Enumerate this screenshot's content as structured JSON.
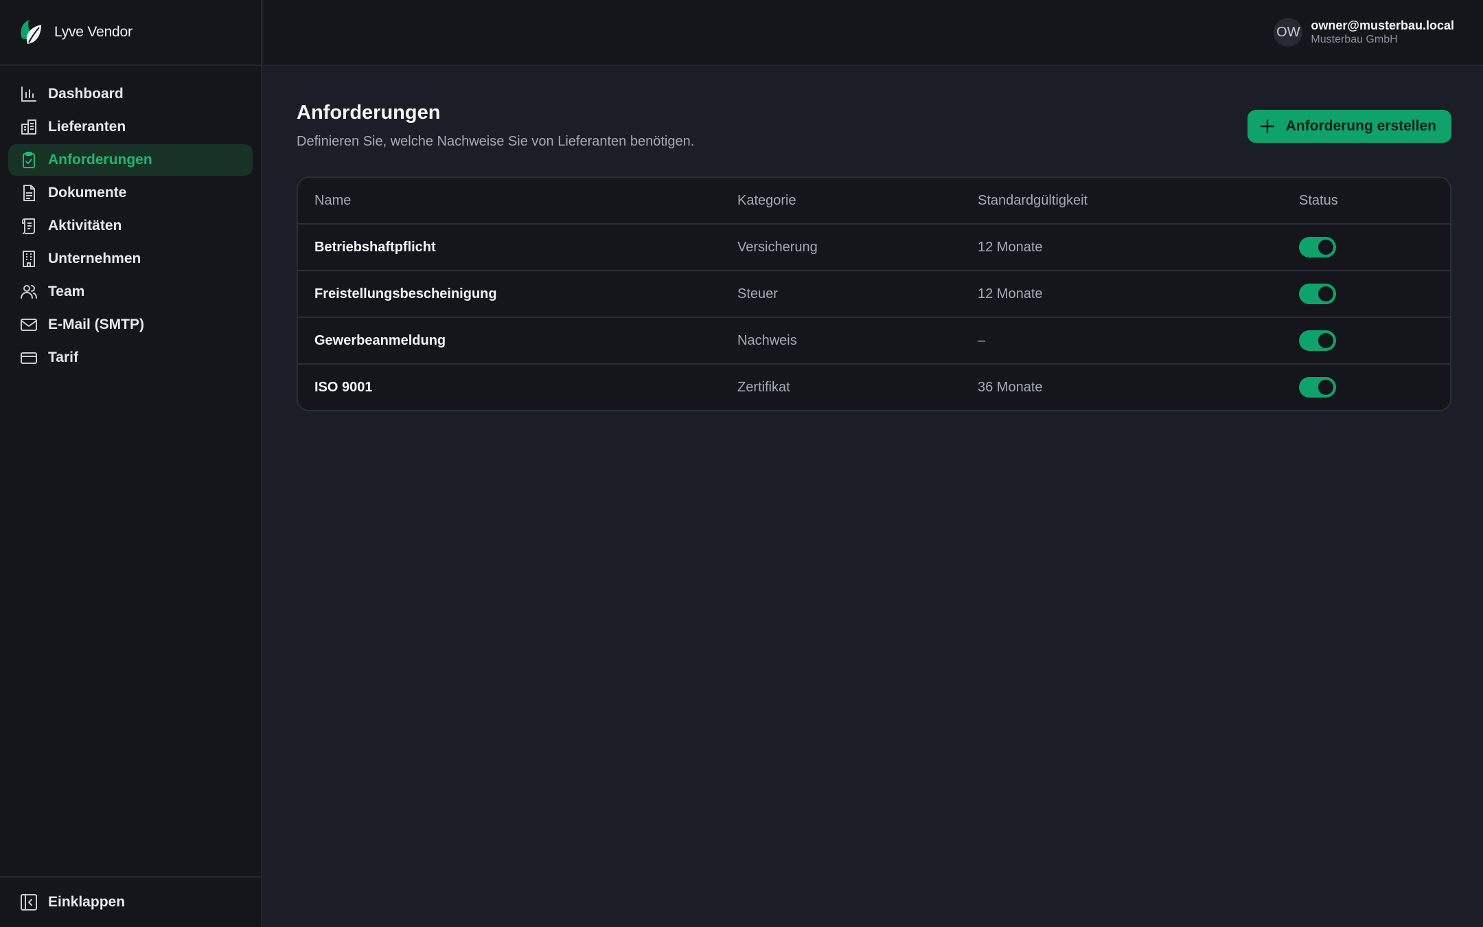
{
  "brand": {
    "name": "Lyve Vendor"
  },
  "sidebar": {
    "items": [
      {
        "label": "Dashboard",
        "icon": "bar-chart-icon",
        "active": false
      },
      {
        "label": "Lieferanten",
        "icon": "buildings-icon",
        "active": false
      },
      {
        "label": "Anforderungen",
        "icon": "clipboard-check-icon",
        "active": true
      },
      {
        "label": "Dokumente",
        "icon": "document-icon",
        "active": false
      },
      {
        "label": "Aktivitäten",
        "icon": "scroll-icon",
        "active": false
      },
      {
        "label": "Unternehmen",
        "icon": "office-building-icon",
        "active": false
      },
      {
        "label": "Team",
        "icon": "users-icon",
        "active": false
      },
      {
        "label": "E-Mail (SMTP)",
        "icon": "mail-icon",
        "active": false
      },
      {
        "label": "Tarif",
        "icon": "credit-card-icon",
        "active": false
      }
    ],
    "collapse_label": "Einklappen"
  },
  "user": {
    "initials": "OW",
    "email": "owner@musterbau.local",
    "organization": "Musterbau GmbH"
  },
  "page": {
    "title": "Anforderungen",
    "subtitle": "Definieren Sie, welche Nachweise Sie von Lieferanten benötigen.",
    "create_button": "Anforderung erstellen"
  },
  "table": {
    "columns": [
      "Name",
      "Kategorie",
      "Standardgültigkeit",
      "Status"
    ],
    "rows": [
      {
        "name": "Betriebshaftpflicht",
        "category": "Versicherung",
        "validity": "12 Monate",
        "active": true
      },
      {
        "name": "Freistellungsbescheinigung",
        "category": "Steuer",
        "validity": "12 Monate",
        "active": true
      },
      {
        "name": "Gewerbeanmeldung",
        "category": "Nachweis",
        "validity": "–",
        "active": true
      },
      {
        "name": "ISO 9001",
        "category": "Zertifikat",
        "validity": "36 Monate",
        "active": true
      }
    ]
  },
  "colors": {
    "accent": "#0fa36b",
    "accent_text": "#22b573",
    "sidebar_bg": "#14161b",
    "main_bg": "#1b1e26"
  }
}
